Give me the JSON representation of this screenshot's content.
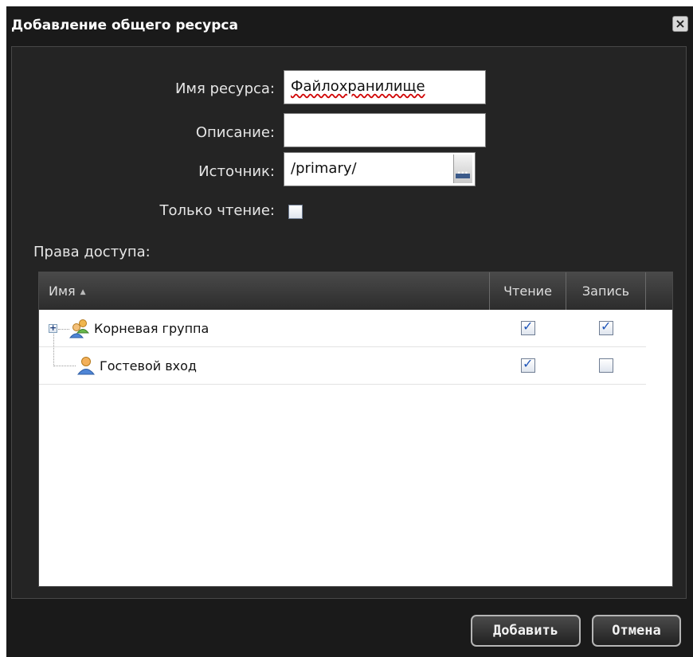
{
  "dialog": {
    "title": "Добавление общего ресурса",
    "close_icon": "close-icon"
  },
  "form": {
    "name_label": "Имя ресурса:",
    "name_value": "Файлохранилище",
    "description_label": "Описание:",
    "description_value": "",
    "source_label": "Источник:",
    "source_value": "/primary/",
    "browse_icon": "ellipsis-icon",
    "readonly_label": "Только чтение:",
    "readonly_checked": false
  },
  "permissions": {
    "section_label": "Права доступа:",
    "columns": {
      "name": "Имя",
      "sort_indicator": "▲",
      "read": "Чтение",
      "write": "Запись"
    },
    "rows": [
      {
        "name": "Корневая группа",
        "icon": "group-icon",
        "expandable": true,
        "read": true,
        "write": true
      },
      {
        "name": "Гостевой вход",
        "icon": "user-icon",
        "expandable": false,
        "read": true,
        "write": false
      }
    ]
  },
  "footer": {
    "add_label": "Добавить",
    "cancel_label": "Отмена"
  },
  "colors": {
    "dialog_bg": "#1a1a1a",
    "panel_bg": "#242424",
    "checkbox_tick": "#1f55b8",
    "spellcheck_underline": "#d00000"
  }
}
